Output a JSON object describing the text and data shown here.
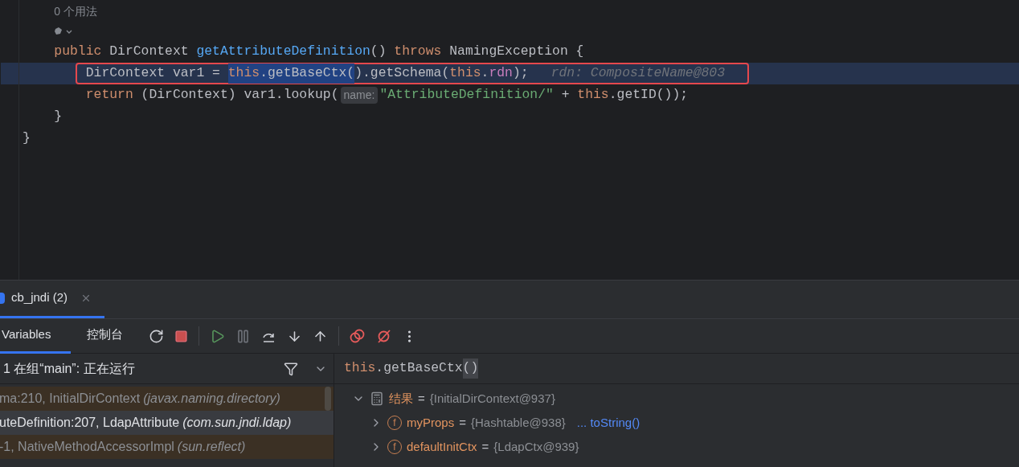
{
  "editor": {
    "lines": [
      {
        "kind": "group",
        "current": false,
        "children": [
          {
            "kind": "usages",
            "text": "0 个用法",
            "current": false
          },
          {
            "kind": "icon",
            "current": false
          },
          {
            "kind": "code",
            "current": false,
            "tokens": [
              {
                "kind": "keyword",
                "text": "public"
              },
              {
                "kind": "plain",
                "text": " DirContext "
              },
              {
                "kind": "method",
                "text": "getAttributeDefinition"
              },
              {
                "kind": "plain",
                "text": "() "
              },
              {
                "kind": "keyword",
                "text": "throws"
              },
              {
                "kind": "plain",
                "text": " NamingException {"
              }
            ],
            "children": [
              {
                "kind": "code",
                "current": true,
                "tokens": [
                  {
                    "kind": "plain",
                    "text": "DirContext var1 = "
                  },
                  {
                    "kind": "selection",
                    "tokens": [
                      {
                        "kind": "keyword",
                        "text": "this"
                      },
                      {
                        "kind": "plain",
                        "text": ".getBaseCtx("
                      }
                    ]
                  },
                  {
                    "kind": "plain",
                    "text": ").getSchema("
                  },
                  {
                    "kind": "keyword",
                    "text": "this"
                  },
                  {
                    "kind": "plain",
                    "text": "."
                  },
                  {
                    "kind": "field",
                    "text": "rdn"
                  },
                  {
                    "kind": "plain",
                    "text": ");"
                  },
                  {
                    "kind": "hint",
                    "text": "rdn: CompositeName@803"
                  }
                ]
              },
              {
                "kind": "code",
                "current": false,
                "tokens": [
                  {
                    "kind": "keyword",
                    "text": "return"
                  },
                  {
                    "kind": "plain",
                    "text": " (DirContext) var1.lookup("
                  },
                  {
                    "kind": "inlay",
                    "text": "name:"
                  },
                  {
                    "kind": "string",
                    "text": "\"AttributeDefinition/\""
                  },
                  {
                    "kind": "plain",
                    "text": " + "
                  },
                  {
                    "kind": "keyword",
                    "text": "this"
                  },
                  {
                    "kind": "plain",
                    "text": ".getID());"
                  }
                ]
              }
            ]
          },
          {
            "kind": "code",
            "current": false,
            "tokens": [
              {
                "kind": "plain",
                "text": "}"
              }
            ]
          }
        ]
      },
      {
        "kind": "code",
        "current": false,
        "tokens": [
          {
            "kind": "plain",
            "text": "}"
          }
        ]
      }
    ]
  },
  "session_tab": {
    "label": "cb_jndi (2)",
    "selected": true
  },
  "toolbar": {
    "tabs": [
      {
        "label": "Variables",
        "selected": true
      },
      {
        "label": "控制台",
        "selected": false
      }
    ]
  },
  "frames": {
    "thread": "1 在组“main”: 正在运行",
    "items": [
      {
        "location": "ma:210, InitialDirContext",
        "package": "(javax.naming.directory)",
        "selected": false
      },
      {
        "location": "uteDefinition:207, LdapAttribute",
        "package": "(com.sun.jndi.ldap)",
        "selected": true
      },
      {
        "location": "-1, NativeMethodAccessorImpl",
        "package": "(sun.reflect)",
        "selected": false
      }
    ]
  },
  "evaluate": {
    "tokens": [
      {
        "kind": "keyword",
        "text": "this"
      },
      {
        "kind": "plain",
        "text": ".getBaseCtx"
      },
      {
        "kind": "brace",
        "text": "()"
      }
    ],
    "tree": [
      {
        "kind": "result",
        "name": "结果",
        "equals": "=",
        "value": "{InitialDirContext@937}",
        "expanded": true,
        "children": [
          {
            "kind": "field",
            "icon": "f",
            "name": "myProps",
            "equals": "=",
            "value": "{Hashtable@938}",
            "link": "... toString()",
            "expanded": false
          },
          {
            "kind": "field",
            "icon": "f",
            "name": "defaultInitCtx",
            "equals": "=",
            "value": "{LdapCtx@939}",
            "expanded": false
          }
        ]
      }
    ]
  }
}
